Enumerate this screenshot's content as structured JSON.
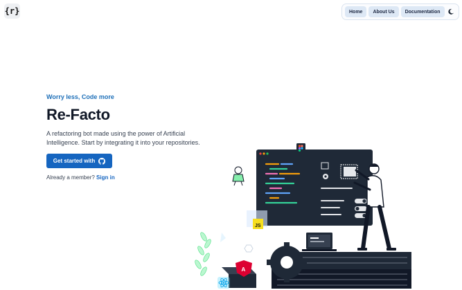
{
  "header": {
    "logo_text": "{r}",
    "nav": [
      {
        "label": "Home"
      },
      {
        "label": "About Us"
      },
      {
        "label": "Documentation"
      }
    ],
    "theme_toggle_icon": "moon-icon"
  },
  "hero": {
    "eyebrow": "Worry less, Code more",
    "title": "Re-Facto",
    "description": "A refactoring bot made using the power of Artificial Intelligence. Start by integrating it into your repositories.",
    "cta_label": "Get started with",
    "cta_icon": "github-icon",
    "member_prompt": "Already a member?",
    "sign_in_label": "Sign in"
  },
  "illustration": {
    "badges": [
      "JS"
    ],
    "icons": [
      "figma-icon",
      "react-icon",
      "angular-icon",
      "gear-icon"
    ]
  },
  "colors": {
    "accent": "#1565c0",
    "eyebrow": "#1d6fb8",
    "nav_button_bg": "#dde8f5",
    "editor_bg": "#1f2937",
    "js_badge": "#f7df1e"
  }
}
